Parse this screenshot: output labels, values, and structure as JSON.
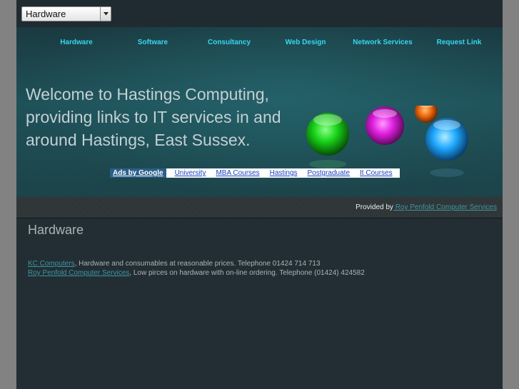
{
  "select": {
    "value": "Hardware"
  },
  "nav": [
    {
      "label": "Hardware"
    },
    {
      "label": "Software"
    },
    {
      "label": "Consultancy"
    },
    {
      "label": "Web Design"
    },
    {
      "label": "Network Services"
    },
    {
      "label": "Request Link"
    }
  ],
  "welcome": {
    "line1": "Welcome to Hastings Computing,",
    "line2": "providing links to IT services in and",
    "line3": "around Hastings, East Sussex."
  },
  "ads": {
    "label": "Ads by Google",
    "links": [
      "University",
      "MBA Courses",
      "Hastings",
      "Postgraduate",
      "It Courses"
    ]
  },
  "provided": {
    "prefix": "Provided by",
    "link": " Roy Penfold Computer Services"
  },
  "content": {
    "heading": "Hardware",
    "entries": [
      {
        "link": "KC Computers",
        "text": ", Hardware and consumables at  reasonable prices. Telephone  01424 714 713"
      },
      {
        "link": "Roy Penfold Computer Services",
        "text": ", Low pirces on hardware with on-line ordering. Telephone (01424) 424582"
      }
    ]
  },
  "colors": {
    "nav": "#36d7f0",
    "link": "#3f95a0",
    "orb_green": "#22e022",
    "orb_magenta": "#e020e0",
    "orb_orange": "#f07010",
    "orb_blue": "#20b0ff"
  }
}
